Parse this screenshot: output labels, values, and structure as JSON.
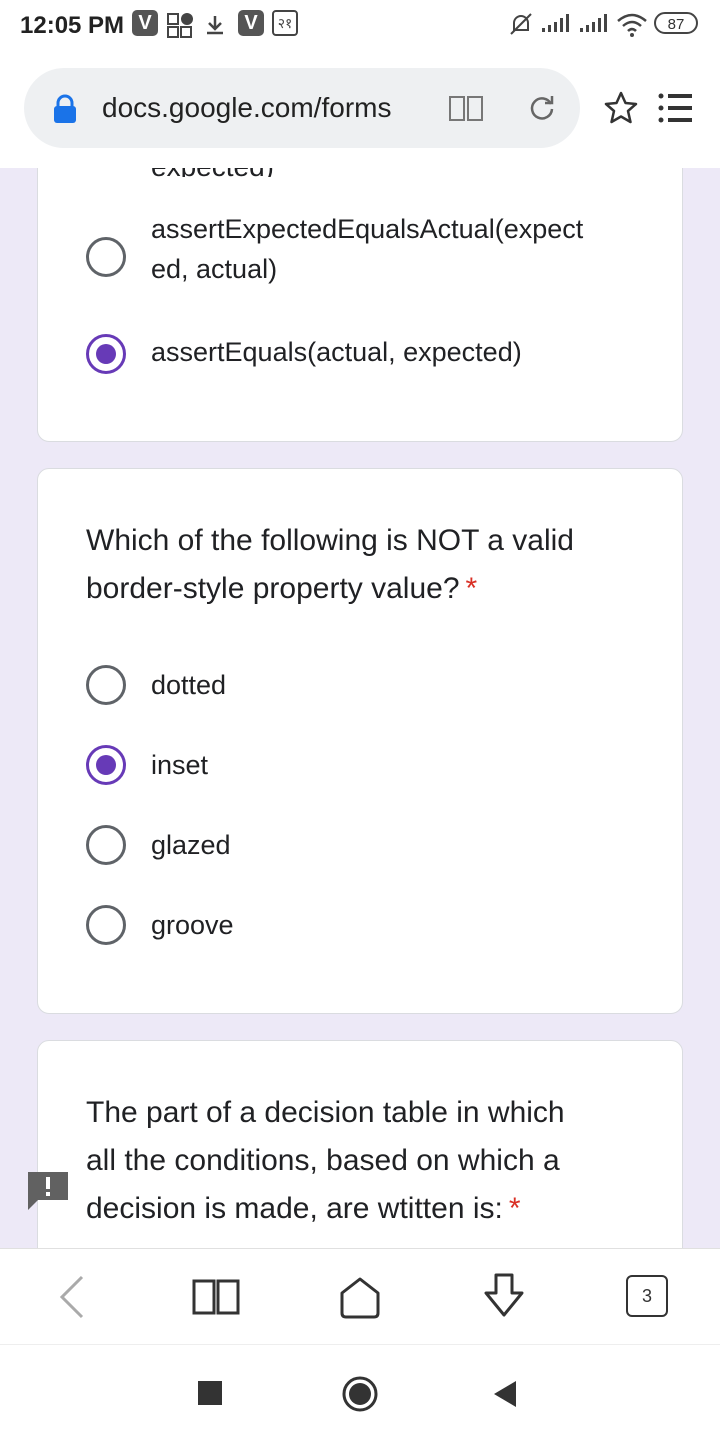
{
  "status_bar": {
    "time": "12:05 PM",
    "badge_v": "V",
    "badge_num": "२१",
    "battery": "87"
  },
  "browser": {
    "url": "docs.google.com/forms"
  },
  "form": {
    "q_prev": {
      "partial_option": "expected)",
      "options": [
        {
          "label_line1": "assertExpectedEqualsActual(expect",
          "label_line2": "ed, actual)",
          "checked": false
        },
        {
          "label_line1": "assertEquals(actual, expected)",
          "checked": true
        }
      ]
    },
    "q2": {
      "line1": "Which of the following is NOT a valid",
      "line2": "border-style property value?",
      "required": "*",
      "options": [
        {
          "label": "dotted",
          "checked": false
        },
        {
          "label": "inset",
          "checked": true
        },
        {
          "label": "glazed",
          "checked": false
        },
        {
          "label": "groove",
          "checked": false
        }
      ]
    },
    "q3": {
      "line1": "The part of a decision table in which",
      "line2": "all the conditions, based on which a",
      "line3": "decision is made, are wtitten is:",
      "required": "*"
    }
  },
  "toolbar": {
    "tab_count": "3"
  },
  "colors": {
    "accent": "#673ab7",
    "background": "#ede9f7",
    "required": "#d93025"
  }
}
